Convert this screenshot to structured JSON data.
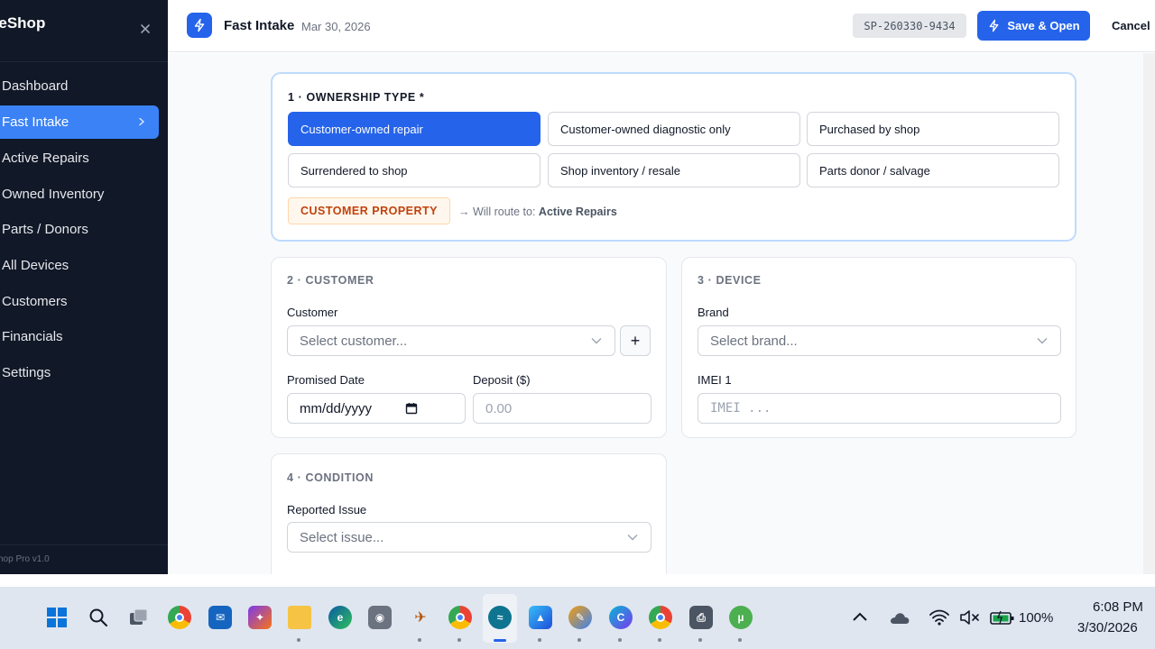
{
  "sidebar": {
    "brand": "neShop",
    "items": [
      {
        "label": "Dashboard"
      },
      {
        "label": "Fast Intake",
        "active": true
      },
      {
        "label": "Active Repairs"
      },
      {
        "label": "Owned Inventory"
      },
      {
        "label": "Parts / Donors"
      },
      {
        "label": "All Devices"
      },
      {
        "label": "Customers"
      },
      {
        "label": "Financials"
      },
      {
        "label": "Settings"
      }
    ],
    "footer": "hop Pro v1.0"
  },
  "header": {
    "title": "Fast Intake",
    "date": "Mar 30, 2026",
    "ticket_id": "SP-260330-9434",
    "save_label": "Save & Open",
    "cancel_label": "Cancel"
  },
  "ownership": {
    "title": "1 · OWNERSHIP TYPE *",
    "options": [
      {
        "label": "Customer-owned repair",
        "selected": true
      },
      {
        "label": "Customer-owned diagnostic only"
      },
      {
        "label": "Purchased by shop"
      },
      {
        "label": "Surrendered to shop"
      },
      {
        "label": "Shop inventory / resale"
      },
      {
        "label": "Parts donor / salvage"
      }
    ],
    "badge": "CUSTOMER PROPERTY",
    "route_prefix": "→ Will route to:",
    "route_target": "Active Repairs"
  },
  "customer": {
    "title": "2 · CUSTOMER",
    "customer_label": "Customer",
    "customer_placeholder": "Select customer...",
    "add_label": "+",
    "promised_label": "Promised Date",
    "promised_placeholder": "mm/dd/yyyy",
    "deposit_label": "Deposit ($)",
    "deposit_placeholder": "0.00"
  },
  "device": {
    "title": "3 · DEVICE",
    "brand_label": "Brand",
    "brand_placeholder": "Select brand...",
    "imei_label": "IMEI 1",
    "imei_placeholder": "IMEI ..."
  },
  "condition": {
    "title": "4 · CONDITION",
    "issue_label": "Reported Issue",
    "issue_placeholder": "Select issue..."
  },
  "taskbar": {
    "battery": "100%",
    "time": "6:08 PM",
    "date": "3/30/2026"
  },
  "colors": {
    "accent": "#2563eb",
    "sidebar_bg": "#111827",
    "badge_text": "#c2410c"
  }
}
